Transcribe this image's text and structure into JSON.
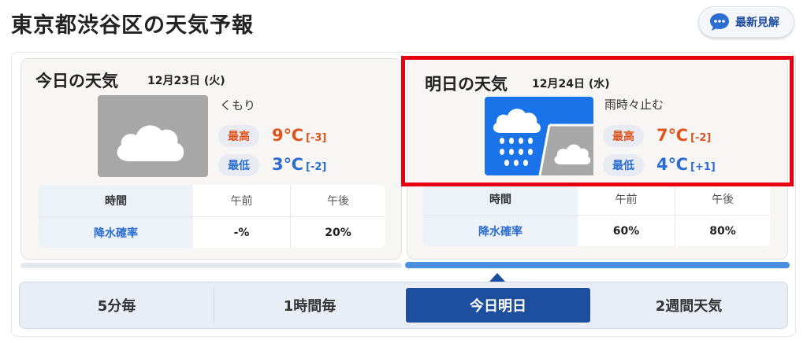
{
  "header": {
    "title": "東京都渋谷区の天気予報",
    "expert_button": {
      "label": "最新見解",
      "icon": "speech-bubble-icon"
    }
  },
  "today": {
    "title": "今日の天気",
    "date": "12月23日 (火)",
    "condition": "くもり",
    "icon": "cloudy-icon",
    "high_label": "最高",
    "high_temp": "9℃",
    "high_diff": "[-3]",
    "low_label": "最低",
    "low_temp": "3℃",
    "low_diff": "[-2]",
    "table": {
      "header": [
        "時間",
        "午前",
        "午後"
      ],
      "row_label": "降水確率",
      "values": [
        "-%",
        "20%"
      ]
    }
  },
  "tomorrow": {
    "title": "明日の天気",
    "date": "12月24日 (水)",
    "condition": "雨時々止む",
    "icon": "rain-then-cloudy-icon",
    "high_label": "最高",
    "high_temp": "7℃",
    "high_diff": "[-2]",
    "low_label": "最低",
    "low_temp": "4℃",
    "low_diff": "[+1]",
    "table": {
      "header": [
        "時間",
        "午前",
        "午後"
      ],
      "row_label": "降水確率",
      "values": [
        "60%",
        "80%"
      ]
    }
  },
  "tabs": [
    {
      "label": "5分毎",
      "selected": false
    },
    {
      "label": "1時間毎",
      "selected": false
    },
    {
      "label": "今日明日",
      "selected": true
    },
    {
      "label": "2週間天気",
      "selected": false
    }
  ],
  "colors": {
    "accent": "#1e4e9e",
    "high": "#e0541c",
    "low": "#2b6dd1",
    "highlight": "#e60012",
    "rain_icon": "#1a73e8",
    "cloud_icon_bg": "#a7a7a7"
  }
}
